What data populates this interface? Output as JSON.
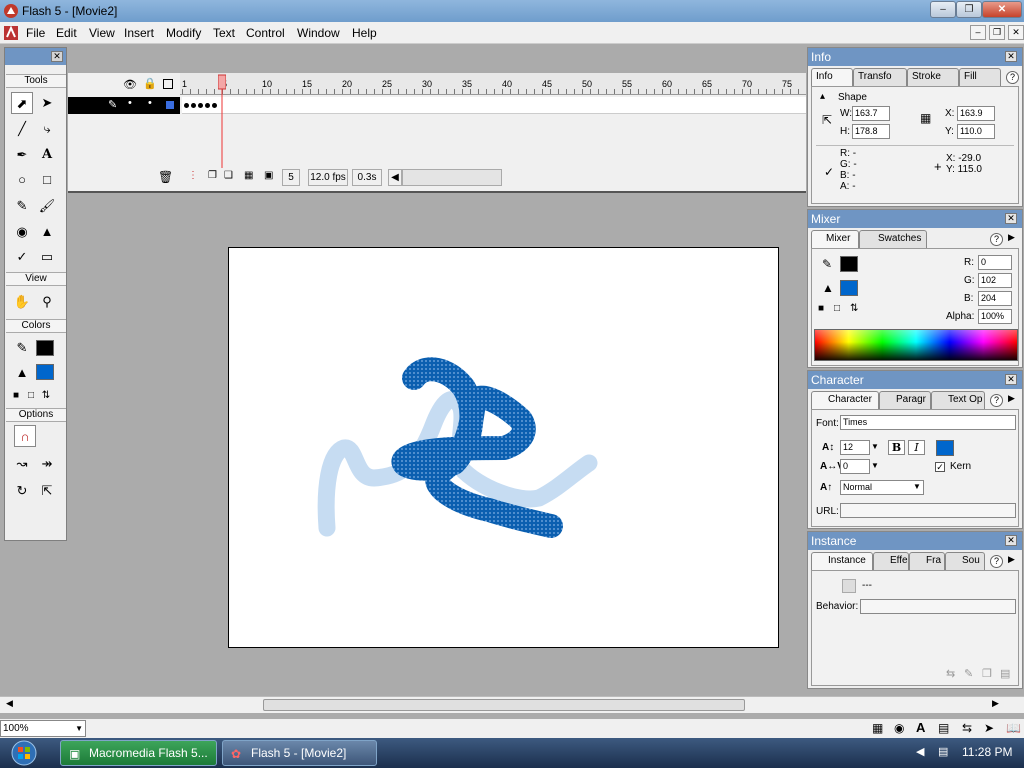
{
  "window": {
    "title": "Flash 5 - [Movie2]"
  },
  "menu": [
    "File",
    "Edit",
    "View",
    "Insert",
    "Modify",
    "Text",
    "Control",
    "Window",
    "Help"
  ],
  "tools_panel": {
    "title": "Tools",
    "sections": {
      "view": "View",
      "colors": "Colors",
      "options": "Options"
    },
    "stroke_color": "#000000",
    "fill_color": "#0066cc"
  },
  "timeline": {
    "ruler": [
      "1",
      "5",
      "10",
      "15",
      "20",
      "25",
      "30",
      "35",
      "40",
      "45",
      "50",
      "55",
      "60",
      "65",
      "70",
      "75"
    ],
    "current_frame": "5",
    "frame_rate": "12.0 fps",
    "elapsed": "0.3s"
  },
  "info_panel": {
    "title": "Info",
    "tabs": [
      "Info",
      "Transfo",
      "Stroke",
      "Fill"
    ],
    "object": "Shape",
    "w_label": "W:",
    "w": "163.7",
    "h_label": "H:",
    "h": "178.8",
    "x_label": "X:",
    "x": "163.9",
    "y_label": "Y:",
    "y": "110.0",
    "r": "R: -",
    "g": "G: -",
    "b": "B: -",
    "a": "A: -",
    "cursor_x": "X: -29.0",
    "cursor_y": "Y: 115.0"
  },
  "mixer_panel": {
    "title": "Mixer",
    "tabs": [
      "Mixer",
      "Swatches"
    ],
    "r_label": "R:",
    "r": "0",
    "g_label": "G:",
    "g": "102",
    "b_label": "B:",
    "b": "204",
    "alpha_label": "Alpha:",
    "alpha": "100%",
    "stroke_color": "#000000",
    "fill_color": "#0066cc"
  },
  "character_panel": {
    "title": "Character",
    "tabs": [
      "Character",
      "Paragr",
      "Text Op"
    ],
    "font_label": "Font:",
    "font": "Times",
    "size": "12",
    "tracking": "0",
    "kern_label": "Kern",
    "baseline": "Normal",
    "url_label": "URL:",
    "bold": "B",
    "italic": "I",
    "text_color": "#0066cc"
  },
  "instance_panel": {
    "title": "Instance",
    "tabs": [
      "Instance",
      "Effe",
      "Fra",
      "Sou"
    ],
    "value": "---",
    "behavior_label": "Behavior:"
  },
  "status": {
    "zoom": "100%"
  },
  "taskbar": {
    "items": [
      "Macromedia Flash 5...",
      "Flash 5 - [Movie2]"
    ],
    "clock": "11:28 PM"
  }
}
